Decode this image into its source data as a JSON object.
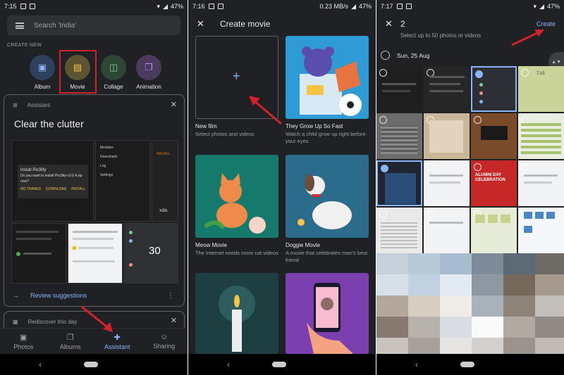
{
  "status": {
    "panel1_time": "7:15",
    "panel2_time": "7:16",
    "panel2_speed": "0.23 MB/s",
    "panel3_time": "7:17",
    "battery": "47%"
  },
  "panel1": {
    "search_placeholder": "Search 'India'",
    "create_new_label": "CREATE NEW",
    "create_items": [
      {
        "label": "Album",
        "icon": "album-icon",
        "color": "#2f3f5e"
      },
      {
        "label": "Movie",
        "icon": "movie-icon",
        "color": "#5c5331"
      },
      {
        "label": "Collage",
        "icon": "collage-icon",
        "color": "#2e4636"
      },
      {
        "label": "Animation",
        "icon": "animation-icon",
        "color": "#4a3a5c"
      }
    ],
    "assistant_card": {
      "header": "Assistant",
      "title": "Clear the clutter",
      "action": "Review suggestions"
    },
    "rediscover_card": {
      "header": "Rediscover this day"
    },
    "bottom_nav": [
      {
        "label": "Photos",
        "icon": "photos-icon",
        "active": false
      },
      {
        "label": "Albums",
        "icon": "albums-icon",
        "active": false
      },
      {
        "label": "Assistant",
        "icon": "assistant-icon",
        "active": true
      },
      {
        "label": "Sharing",
        "icon": "sharing-icon",
        "active": false
      }
    ],
    "screenshot_texts": {
      "install_title": "Install Pix3lify",
      "install_question": "Do you want to install Pix3lify-v3.0.4.zip now?",
      "no_thanks": "NO THANKS",
      "download": "DOWNLOAD",
      "install": "INSTALL",
      "modules": "Modules",
      "downloads": "Downloads",
      "log": "Log",
      "settings": "Settings",
      "big_number": "30",
      "xda": "xda"
    }
  },
  "panel2": {
    "title": "Create movie",
    "movies": [
      {
        "name": "New film",
        "desc": "Select photos and videos"
      },
      {
        "name": "They Grow Up So Fast",
        "desc": "Watch a child grow up right before your eyes"
      },
      {
        "name": "Meow Movie",
        "desc": "The Internet needs more cat videos"
      },
      {
        "name": "Doggie Movie",
        "desc": "A movie that celebrates man's best friend"
      }
    ]
  },
  "panel3": {
    "count": "2",
    "create_label": "Create",
    "subtitle": "Select up to 50 photos or videos",
    "date": "Sun, 25 Aug",
    "phone_time": "7:15",
    "event_text": "ALUMNI DAY CELEBRATION"
  },
  "colors": {
    "background": "#202124",
    "accent": "#8ab4f8",
    "highlight_red": "#d3222a"
  }
}
